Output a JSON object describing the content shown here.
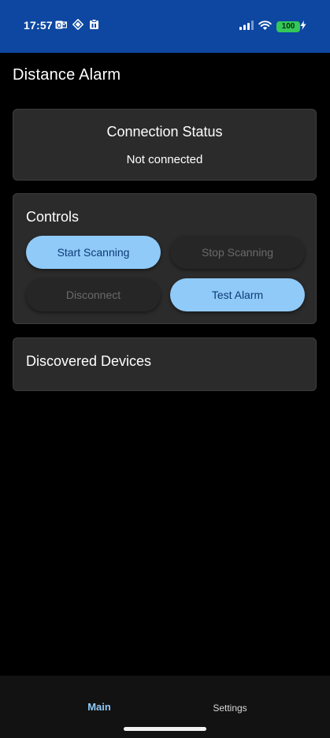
{
  "status_bar": {
    "time": "17:57",
    "left_icons": [
      "mail-icon",
      "location-diamond-icon",
      "clipboard-icon"
    ],
    "right_icons": [
      "cellular-signal-icon",
      "wifi-icon",
      "battery-icon"
    ],
    "battery_level": "100",
    "bar_color": "#0d47a1",
    "battery_color": "#34c759"
  },
  "header": {
    "title": "Distance Alarm"
  },
  "connection": {
    "title": "Connection Status",
    "status": "Not connected"
  },
  "controls": {
    "title": "Controls",
    "start_label": "Start Scanning",
    "stop_label": "Stop Scanning",
    "disconnect_label": "Disconnect",
    "test_label": "Test Alarm",
    "primary_color": "#90caf9"
  },
  "devices": {
    "title": "Discovered Devices"
  },
  "bottom_nav": {
    "tabs": [
      {
        "label": "Main",
        "active": true
      },
      {
        "label": "Settings",
        "active": false
      }
    ],
    "active_color": "#90caf9"
  }
}
